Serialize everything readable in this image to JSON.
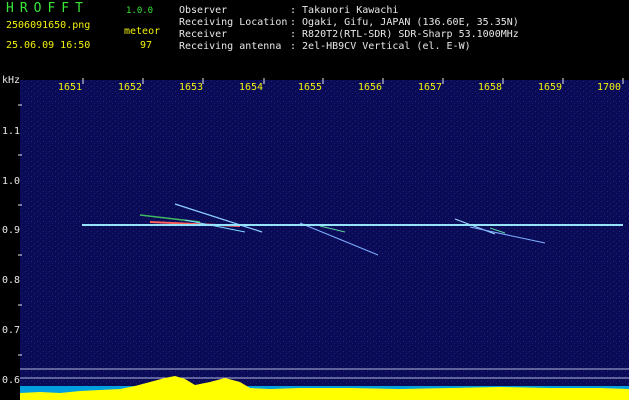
{
  "header": {
    "logo": "HROFFT",
    "version": "1.0.0",
    "filename": "2506091650.png",
    "mode": "meteor",
    "datetime": "25.06.09 16:50",
    "count": "97",
    "info": [
      {
        "label": "Observer",
        "value": ": Takanori Kawachi"
      },
      {
        "label": "Receiving Location",
        "value": ": Ogaki, Gifu, JAPAN (136.60E, 35.35N)"
      },
      {
        "label": "Receiver",
        "value": ": R820T2(RTL-SDR) SDR-Sharp 53.1000MHz"
      },
      {
        "label": "Receiving antenna",
        "value": ": 2el-HB9CV Vertical (el. E-W)"
      }
    ]
  },
  "axes": {
    "y_unit": "kHz",
    "x_ticks": [
      "1651",
      "1652",
      "1653",
      "1654",
      "1655",
      "1656",
      "1657",
      "1658",
      "1659",
      "1700"
    ],
    "y_ticks": [
      "1.1",
      "1.0",
      "0.9",
      "0.8",
      "0.7",
      "0.6"
    ]
  },
  "colors": {
    "background": "#000000",
    "spectrum_bg": "#0a0a55",
    "text_green": "#39e639",
    "text_yellow": "#f2f20a",
    "carrier": "#7fd9ff",
    "histogram": "#ffff00",
    "noise_floor": "#00c8ff"
  }
}
